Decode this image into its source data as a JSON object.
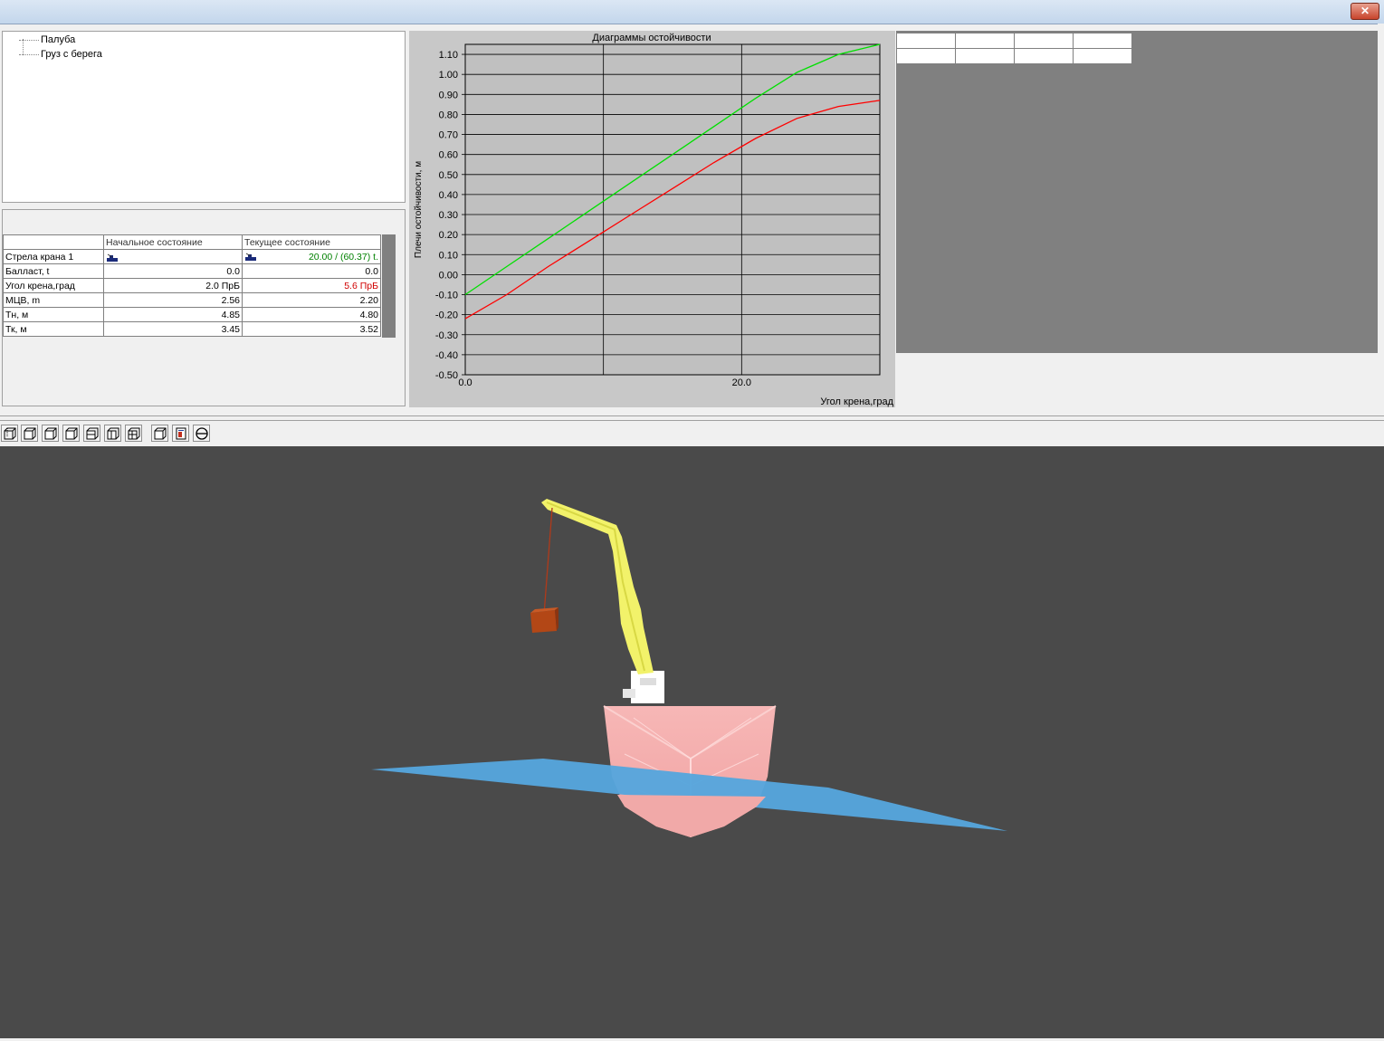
{
  "window": {
    "close_label": "✕"
  },
  "tree": {
    "items": [
      "Палуба",
      "Груз с берега"
    ]
  },
  "state_table": {
    "headers": [
      "",
      "Начальное состояние",
      "Текущее состояние"
    ],
    "rows": [
      {
        "label": "Стрела крана 1",
        "initial": "",
        "current": "20.00 / (60.37) t.",
        "current_color": "#008000"
      },
      {
        "label": "Балласт, t",
        "initial": "0.0",
        "current": "0.0",
        "current_color": "#000000"
      },
      {
        "label": "Угол крена,град",
        "initial": "2.0  ПрБ",
        "current": "5.6  ПрБ",
        "current_color": "#d00000"
      },
      {
        "label": "МЦВ, m",
        "initial": "2.56",
        "current": "2.20",
        "current_color": "#000000"
      },
      {
        "label": "Тн, м",
        "initial": "4.85",
        "current": "4.80",
        "current_color": "#000000"
      },
      {
        "label": "Тк, м",
        "initial": "3.45",
        "current": "3.52",
        "current_color": "#000000"
      }
    ]
  },
  "chart_data": {
    "type": "line",
    "title": "Диаграммы остойчивости",
    "xlabel": "Угол крена,град",
    "ylabel": "Плечи остойчивости, м",
    "xlim": [
      0,
      30
    ],
    "ylim": [
      -0.5,
      1.15
    ],
    "x_ticks": [
      "0.0",
      "20.0"
    ],
    "x_tick_values": [
      0,
      20
    ],
    "x_grid_values": [
      0,
      10,
      20,
      30
    ],
    "y_ticks": [
      "1.10",
      "1.00",
      "0.90",
      "0.80",
      "0.70",
      "0.60",
      "0.50",
      "0.40",
      "0.30",
      "0.20",
      "0.10",
      "0.00",
      "-0.10",
      "-0.20",
      "-0.30",
      "-0.40",
      "-0.50"
    ],
    "y_tick_values": [
      1.1,
      1.0,
      0.9,
      0.8,
      0.7,
      0.6,
      0.5,
      0.4,
      0.3,
      0.2,
      0.1,
      0.0,
      -0.1,
      -0.2,
      -0.3,
      -0.4,
      -0.5
    ],
    "grid": true,
    "series": [
      {
        "color": "#00e000",
        "x": [
          0,
          3,
          6,
          9,
          12,
          15,
          18,
          21,
          24,
          27,
          30
        ],
        "y": [
          -0.1,
          0.04,
          0.18,
          0.32,
          0.46,
          0.6,
          0.74,
          0.88,
          1.01,
          1.1,
          1.15
        ]
      },
      {
        "color": "#ff0000",
        "x": [
          0,
          3,
          6,
          9,
          12,
          15,
          18,
          21,
          24,
          27,
          30
        ],
        "y": [
          -0.22,
          -0.1,
          0.04,
          0.17,
          0.3,
          0.43,
          0.56,
          0.68,
          0.78,
          0.84,
          0.87
        ]
      }
    ]
  },
  "toolbar": {
    "buttons": [
      "view-front-icon",
      "view-back-icon",
      "view-left-icon",
      "view-right-icon",
      "view-top-icon",
      "view-bottom-icon",
      "view-iso-icon",
      "cargo-icon",
      "waterline-icon"
    ]
  },
  "scene": {
    "background": "#4a4a4a",
    "hull_color": "#f3a9a8",
    "water_color": "#55a5dd",
    "boom_color": "#f0f060",
    "cargo_color": "#b34716"
  }
}
